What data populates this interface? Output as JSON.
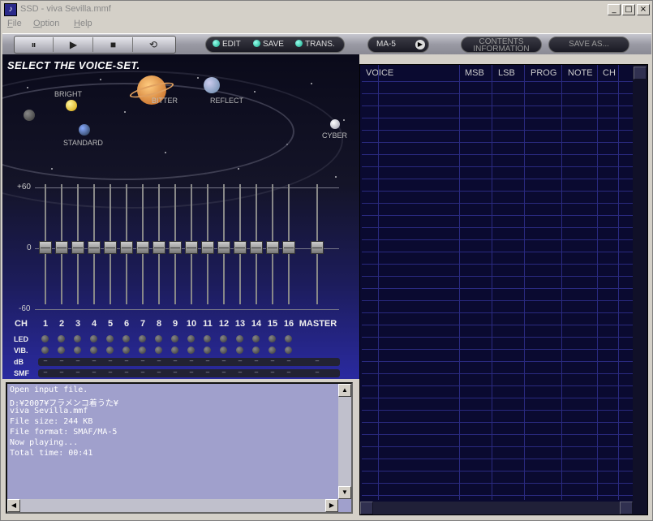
{
  "window": {
    "title": "SSD - viva Sevilla.mmf",
    "icon": "app-icon"
  },
  "window_controls": {
    "minimize": "_",
    "maximize": "□",
    "close": "×"
  },
  "menu": [
    {
      "label": "File",
      "accel": "F",
      "rest": "ile"
    },
    {
      "label": "Option",
      "accel": "O",
      "rest": "ption"
    },
    {
      "label": "Help",
      "accel": "H",
      "rest": "elp"
    }
  ],
  "transport": {
    "pause": "⏸",
    "play": "▶",
    "stop": "■",
    "repeat": "⟲"
  },
  "toolbar": {
    "edit": "EDIT",
    "save": "SAVE",
    "trans": "TRANS.",
    "device": "MA-5",
    "contents_line1": "CONTENTS",
    "contents_line2": "INFORMATION",
    "save_as": "SAVE AS..."
  },
  "voiceset": {
    "title": "SELECT THE VOICE-SET.",
    "planets": [
      "BRIGHT",
      "BITTER",
      "REFLECT",
      "STANDARD",
      "CYBER"
    ]
  },
  "mixer": {
    "scale": {
      "top": "+60",
      "mid": "0",
      "bottom": "-60"
    },
    "ch_label": "CH",
    "channels": [
      "1",
      "2",
      "3",
      "4",
      "5",
      "6",
      "7",
      "8",
      "9",
      "10",
      "11",
      "12",
      "13",
      "14",
      "15",
      "16"
    ],
    "master_label": "MASTER",
    "rows": {
      "led": "LED",
      "vib": "VIB.",
      "db": "dB",
      "smf": "SMF"
    },
    "dash": "–"
  },
  "log": {
    "lines": [
      "Open input file.",
      "D:¥2007¥フラメンコ着うた¥",
      "viva Sevilla.mmf",
      "File size: 244 KB",
      "File format: SMAF/MA-5",
      "Now playing...",
      "Total time: 00:41"
    ]
  },
  "table": {
    "columns": [
      "VOICE",
      "MSB",
      "LSB",
      "PROG",
      "NOTE",
      "CH"
    ]
  },
  "colors": {
    "accent_green": "#22aa88",
    "table_bg": "#0a0a30",
    "grid": "#2a2a80"
  }
}
